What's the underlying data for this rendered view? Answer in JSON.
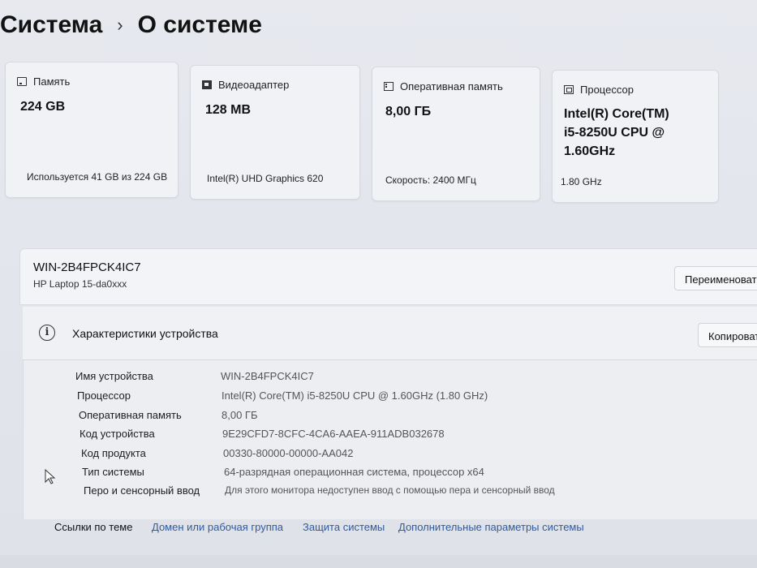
{
  "breadcrumb": {
    "parent": "Система",
    "separator": "›",
    "current": "О системе"
  },
  "cards": [
    {
      "icon": "drive-icon",
      "title": "Память",
      "value": "224 GB",
      "sub": "Используется 41 GB из 224 GB"
    },
    {
      "icon": "gpu-icon",
      "title": "Видеоадаптер",
      "value": "128 MB",
      "sub": "Intel(R) UHD Graphics 620"
    },
    {
      "icon": "ram-icon",
      "title": "Оперативная память",
      "value": "8,00 ГБ",
      "sub": "Скорость: 2400 МГц"
    },
    {
      "icon": "cpu-icon",
      "title": "Процессор",
      "value": "Intel(R) Core(TM) i5-8250U CPU @ 1.60GHz",
      "sub": "1.80 GHz"
    }
  ],
  "device": {
    "name": "WIN-2B4FPCK4IC7",
    "model": "HP Laptop 15-da0xxx",
    "rename_label": "Переименовать"
  },
  "specs": {
    "title": "Характеристики устройства",
    "copy_label": "Копировать",
    "rows": [
      {
        "label": "Имя устройства",
        "value": "WIN-2B4FPCK4IC7"
      },
      {
        "label": "Процессор",
        "value": "Intel(R) Core(TM) i5-8250U CPU @ 1.60GHz (1.80 GHz)"
      },
      {
        "label": "Оперативная память",
        "value": "8,00 ГБ"
      },
      {
        "label": "Код устройства",
        "value": "9E29CFD7-8CFC-4CA6-AAEA-911ADB032678"
      },
      {
        "label": "Код продукта",
        "value": "00330-80000-00000-AA042"
      },
      {
        "label": "Тип системы",
        "value": "64-разрядная операционная система, процессор x64"
      },
      {
        "label": "Перо и сенсорный ввод",
        "value": "Для этого монитора недоступен ввод с помощью пера и сенсорный ввод"
      }
    ]
  },
  "related": {
    "label": "Ссылки по теме",
    "links": [
      "Домен или рабочая группа",
      "Защита системы",
      "Дополнительные параметры системы"
    ]
  }
}
